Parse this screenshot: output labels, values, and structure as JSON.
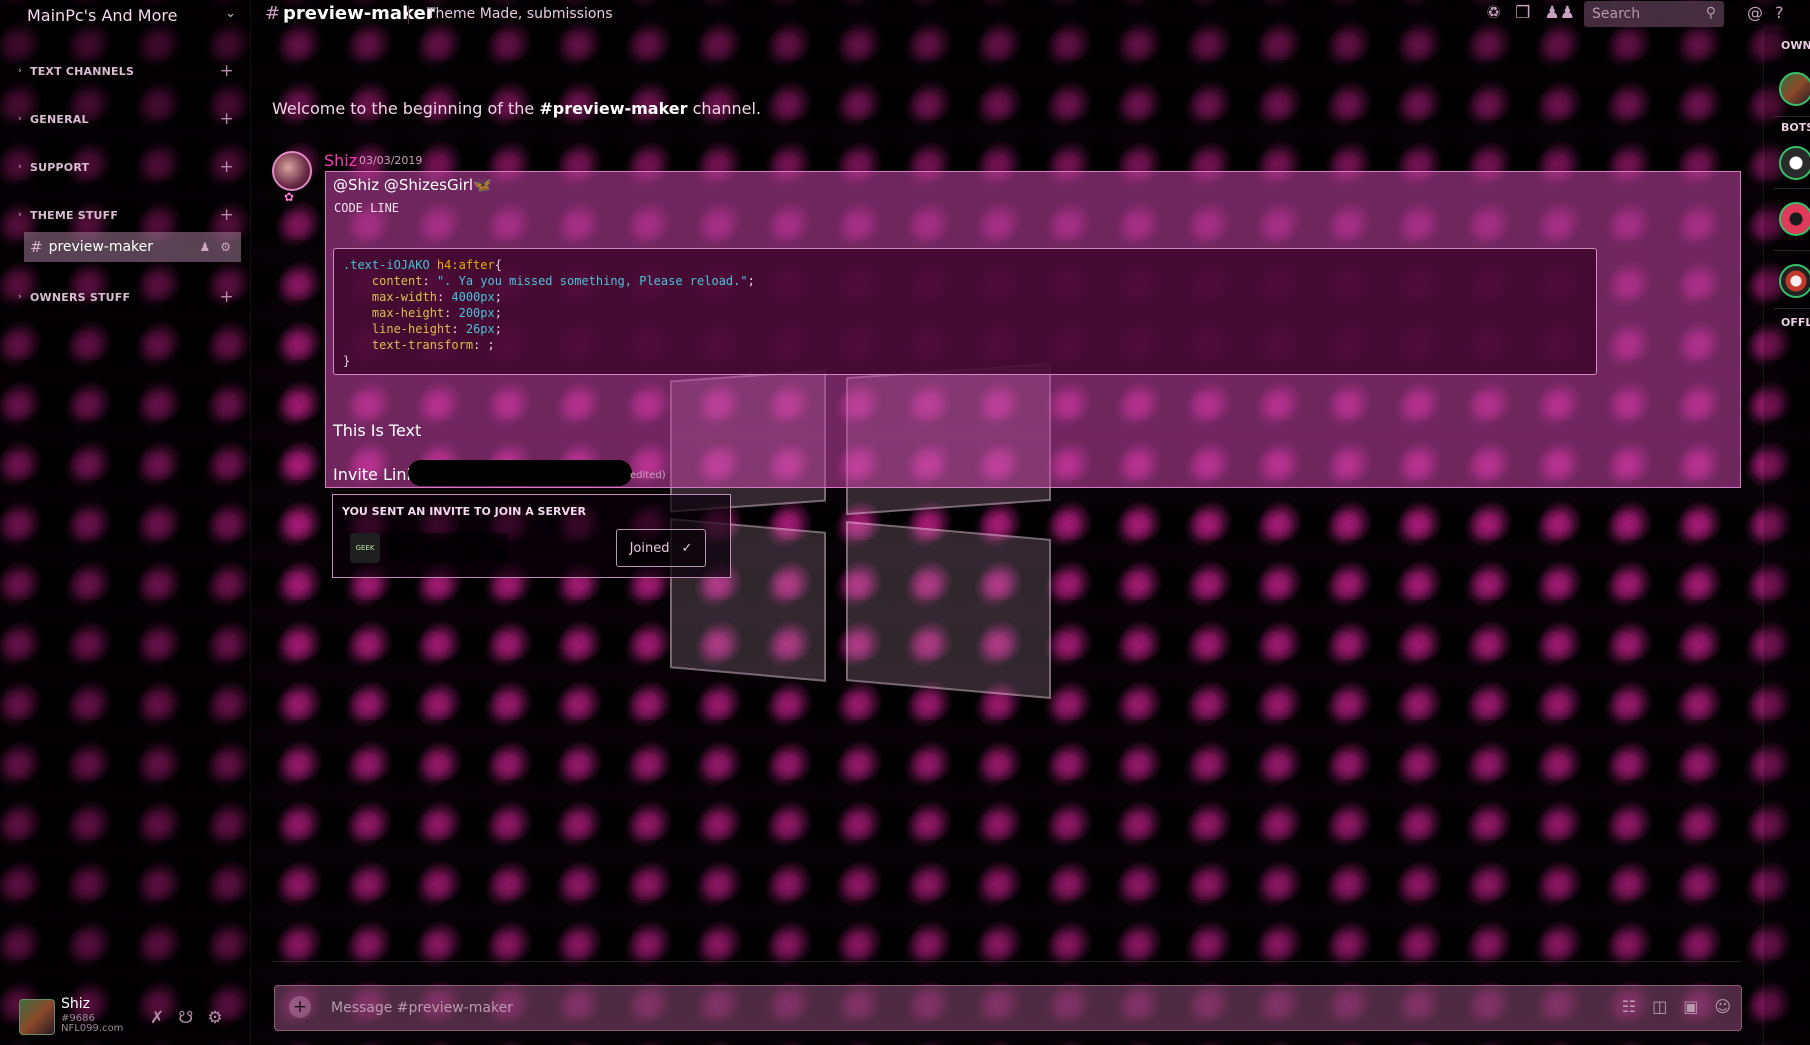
{
  "server": {
    "name": "MainPc's And More",
    "dropdown_icon": "chevron-down-icon"
  },
  "categories": [
    {
      "label": "TEXT CHANNELS"
    },
    {
      "label": "GENERAL"
    },
    {
      "label": "SUPPORT"
    },
    {
      "label": "THEME STUFF"
    },
    {
      "label": "OWNERS STUFF"
    }
  ],
  "active_channel": {
    "name": "preview-maker"
  },
  "topbar": {
    "channel": "preview-maker",
    "topic": "Theme Made, submissions",
    "search_placeholder": "Search"
  },
  "welcome": {
    "prefix": "Welcome to the beginning of the ",
    "channel": "#preview-maker",
    "suffix": " channel."
  },
  "message": {
    "author": "Shiz",
    "timestamp": "03/03/2019",
    "mention": "@Shiz @ShizesGirl🦋",
    "code_inline": "CODE LINE",
    "code_block": {
      "selector": ".text-iOJAKO",
      "element": " h4:after",
      "open": "{",
      "lines": [
        {
          "prop": "content",
          "value": "\". Ya you missed something, Please reload.\""
        },
        {
          "prop": "max-width",
          "value": "4000px"
        },
        {
          "prop": "max-height",
          "value": "200px"
        },
        {
          "prop": "line-height",
          "value": "26px"
        },
        {
          "prop": "text-transform",
          "value": ""
        }
      ],
      "close": "}"
    },
    "text": "This Is Text",
    "invite_label": "Invite Link",
    "edited": "edited)"
  },
  "invite_card": {
    "title": "YOU SENT AN INVITE TO JOIN A SERVER",
    "server_icon_text": "GEEK",
    "button_label": "Joined",
    "button_icon": "checkmark-icon"
  },
  "composer": {
    "placeholder": "Message #preview-maker"
  },
  "user": {
    "name": "Shiz",
    "tag": "#9686",
    "note": "NFL099.com"
  },
  "members": {
    "headers": [
      "OWN",
      "BOTS",
      "OFFL"
    ]
  },
  "colors": {
    "accent_pink": "#ff3cb8",
    "message_bg": "#c846aa",
    "online_green": "#36c06a"
  }
}
